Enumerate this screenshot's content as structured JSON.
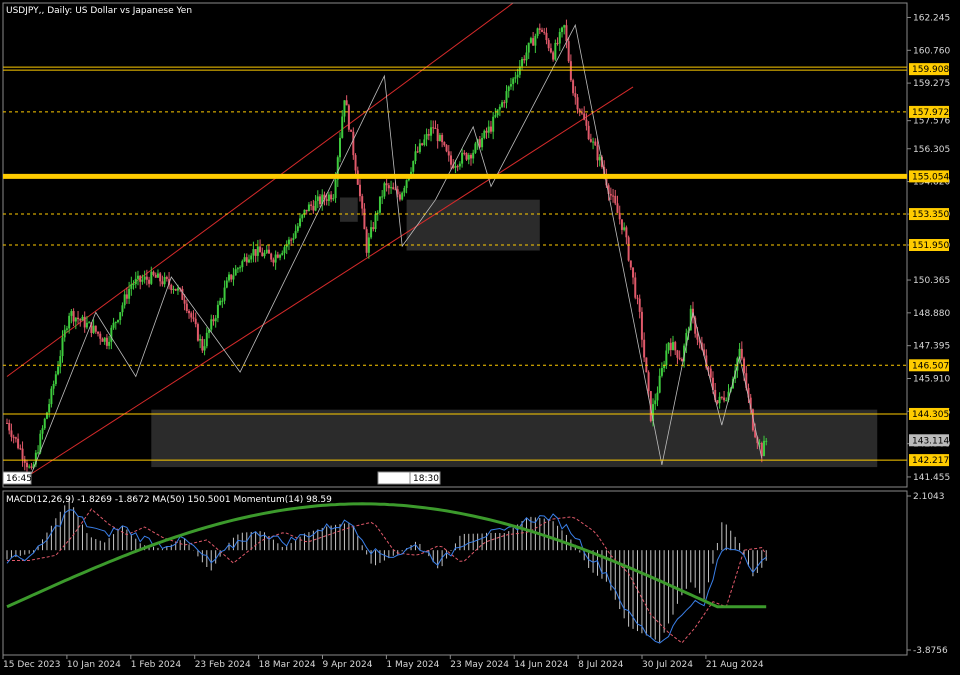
{
  "colors": {
    "background": "#000000",
    "bull": "#3ecb3e",
    "bear": "#e0596a",
    "channel": "#d42a2a",
    "level": "#ffcc00",
    "zigzag": "#bdbdbd",
    "zone": "#3a3a3a",
    "macd_line": "#3a7fe8",
    "macd_hist": "#e8e8e8",
    "macd_signal": "#e0596a",
    "ma50": "#3c9a2c"
  },
  "chart_data": [
    {
      "type": "candlestick",
      "symbol_title": "USDJPY,, Daily:  US Dollar vs Japanese Yen",
      "ylim": [
        141.0,
        162.9
      ],
      "price_ticks": [
        "162.245",
        "160.760",
        "159.275",
        "157.576",
        "156.305",
        "154.820",
        "153.350",
        "151.950",
        "150.365",
        "148.880",
        "147.395",
        "145.910",
        "144.426",
        "142.960",
        "141.455"
      ],
      "level_labels": [
        {
          "value": 159.908,
          "label": "159.908",
          "style": "double"
        },
        {
          "value": 157.972,
          "label": "157.972",
          "style": "dashed"
        },
        {
          "value": 155.054,
          "label": "155.054",
          "style": "thick"
        },
        {
          "value": 153.35,
          "label": "153.350",
          "style": "dashed"
        },
        {
          "value": 151.95,
          "label": "151.950",
          "style": "dashed"
        },
        {
          "value": 146.507,
          "label": "146.507",
          "style": "dashed"
        },
        {
          "value": 144.305,
          "label": "144.305",
          "style": "solid"
        },
        {
          "value": 142.217,
          "label": "142.217",
          "style": "solid"
        }
      ],
      "current_price": {
        "value": 143.114,
        "label": "143.114"
      },
      "time_label_left": "16:45",
      "time_label_mid": "18:30",
      "x_ticks": [
        "15 Dec 2023",
        "10 Jan 2024",
        "1 Feb 2024",
        "23 Feb 2024",
        "18 Mar 2024",
        "9 Apr 2024",
        "1 May 2024",
        "23 May 2024",
        "14 Jun 2024",
        "8 Jul 2024",
        "30 Jul 2024",
        "21 Aug 2024"
      ],
      "key_points": [
        [
          0,
          143.9
        ],
        [
          8,
          142.3
        ],
        [
          11,
          141.6
        ],
        [
          20,
          145.2
        ],
        [
          28,
          148.9
        ],
        [
          38,
          148.2
        ],
        [
          45,
          147.6
        ],
        [
          56,
          150.2
        ],
        [
          66,
          150.5
        ],
        [
          75,
          150.1
        ],
        [
          80,
          149.5
        ],
        [
          88,
          147.3
        ],
        [
          100,
          150.4
        ],
        [
          110,
          151.7
        ],
        [
          120,
          151.4
        ],
        [
          128,
          152.2
        ],
        [
          135,
          153.6
        ],
        [
          147,
          154.3
        ],
        [
          152,
          158.7
        ],
        [
          158,
          154.9
        ],
        [
          162,
          151.8
        ],
        [
          170,
          154.6
        ],
        [
          177,
          154.2
        ],
        [
          184,
          156.0
        ],
        [
          192,
          157.3
        ],
        [
          200,
          155.6
        ],
        [
          210,
          156.2
        ],
        [
          218,
          157.3
        ],
        [
          225,
          158.8
        ],
        [
          232,
          160.3
        ],
        [
          240,
          161.8
        ],
        [
          246,
          160.6
        ],
        [
          251,
          161.8
        ],
        [
          255,
          158.9
        ],
        [
          262,
          157.0
        ],
        [
          268,
          155.5
        ],
        [
          272,
          154.2
        ],
        [
          278,
          152.6
        ],
        [
          285,
          148.7
        ],
        [
          290,
          144.2
        ],
        [
          294,
          145.8
        ],
        [
          298,
          147.6
        ],
        [
          304,
          146.8
        ],
        [
          308,
          148.8
        ],
        [
          314,
          146.8
        ],
        [
          320,
          144.8
        ],
        [
          325,
          145.3
        ],
        [
          330,
          147.2
        ],
        [
          336,
          143.8
        ],
        [
          340,
          142.6
        ],
        [
          342,
          143.1
        ]
      ],
      "channel_upper": [
        [
          0,
          146.0
        ],
        [
          228,
          162.9
        ]
      ],
      "channel_lower": [
        [
          11,
          141.6
        ],
        [
          282,
          159.1
        ]
      ],
      "zigzag": [
        [
          11,
          141.6
        ],
        [
          40,
          148.9
        ],
        [
          58,
          146.0
        ],
        [
          74,
          150.5
        ],
        [
          105,
          146.2
        ],
        [
          170,
          159.6
        ],
        [
          178,
          151.9
        ],
        [
          193,
          154.0
        ],
        [
          210,
          157.3
        ],
        [
          218,
          154.6
        ],
        [
          256,
          161.9
        ],
        [
          295,
          142.0
        ],
        [
          309,
          148.9
        ],
        [
          322,
          143.8
        ],
        [
          330,
          146.9
        ],
        [
          340,
          142.3
        ]
      ],
      "zones": [
        {
          "x0": 65,
          "x1": 392,
          "y0": 144.5,
          "y1": 141.9
        },
        {
          "x0": 180,
          "x1": 240,
          "y0": 154.0,
          "y1": 151.7
        },
        {
          "x0": 150,
          "x1": 158,
          "y0": 154.1,
          "y1": 153.0
        }
      ]
    },
    {
      "type": "line",
      "indicator_title": "MACD(12,26,9) -1.8269 -1.8672 MA(50) 150.5001 Momentum(14) 98.59",
      "ylim": [
        -3.8756,
        2.1043
      ],
      "y_ticks": [
        "2.1043",
        "-3.8756"
      ],
      "series": [
        {
          "name": "MACD",
          "points": [
            [
              0,
              -0.4
            ],
            [
              12,
              -0.2
            ],
            [
              20,
              0.6
            ],
            [
              28,
              1.6
            ],
            [
              36,
              1.0
            ],
            [
              44,
              0.6
            ],
            [
              52,
              0.9
            ],
            [
              60,
              0.5
            ],
            [
              70,
              0.2
            ],
            [
              80,
              0.4
            ],
            [
              92,
              -0.5
            ],
            [
              105,
              0.4
            ],
            [
              115,
              0.7
            ],
            [
              125,
              0.3
            ],
            [
              135,
              0.6
            ],
            [
              145,
              0.9
            ],
            [
              155,
              1.1
            ],
            [
              165,
              -0.1
            ],
            [
              175,
              -0.2
            ],
            [
              185,
              0.2
            ],
            [
              195,
              -0.5
            ],
            [
              205,
              0.3
            ],
            [
              215,
              0.6
            ],
            [
              225,
              0.7
            ],
            [
              235,
              1.2
            ],
            [
              245,
              1.3
            ],
            [
              255,
              0.7
            ],
            [
              262,
              -0.2
            ],
            [
              270,
              -0.9
            ],
            [
              280,
              -2.5
            ],
            [
              288,
              -3.2
            ],
            [
              294,
              -3.6
            ],
            [
              300,
              -3.0
            ],
            [
              308,
              -2.0
            ],
            [
              314,
              -2.2
            ],
            [
              322,
              0.0
            ],
            [
              330,
              0.1
            ],
            [
              336,
              -0.7
            ],
            [
              342,
              -0.4
            ]
          ]
        }
      ]
    }
  ]
}
